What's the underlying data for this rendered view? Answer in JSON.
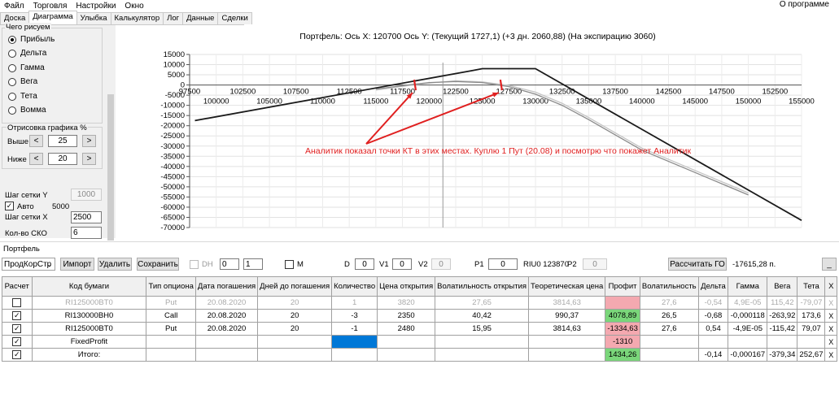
{
  "menu": {
    "items": [
      "Файл",
      "Торговля",
      "Настройки",
      "Окно"
    ],
    "about": "О программе"
  },
  "tabs": [
    "Доска",
    "Диаграмма",
    "Улыбка",
    "Калькулятор",
    "Лог",
    "Данные",
    "Сделки"
  ],
  "active_tab": "Диаграмма",
  "left": {
    "group_title": "Чего рисуем",
    "radios": [
      "Прибыль",
      "Дельта",
      "Гамма",
      "Вега",
      "Тета",
      "Вомма"
    ],
    "selected_radio": "Прибыль",
    "range_title": "Отрисовка графика %",
    "above_label": "Выше",
    "above_value": "25",
    "below_label": "Ниже",
    "below_value": "20",
    "btn_left": "<",
    "btn_right": ">",
    "grid_y_label": "Шаг сетки Y",
    "grid_y_value": "1000",
    "auto_label": "Авто",
    "auto_value": "5000",
    "auto_check": "✓",
    "grid_x_label": "Шаг сетки X",
    "grid_x_value": "2500",
    "sko_label": "Кол-во СКО",
    "sko_value": "6"
  },
  "chart_data": {
    "type": "line",
    "title": "Портфель: Ось X: 120700 Ось Y:  (Текущий 1727,1)  (+3 дн. 2060,88)  (На экспирацию 3060)",
    "xlim": [
      97500,
      155000
    ],
    "ylim": [
      -70000,
      15000
    ],
    "ytick_step": 5000,
    "xticks_top": [
      97500,
      102500,
      107500,
      112500,
      117500,
      122500,
      127500,
      132500,
      137500,
      142500,
      147500,
      152500
    ],
    "xticks_bottom": [
      100000,
      105000,
      110000,
      115000,
      120000,
      125000,
      130000,
      135000,
      140000,
      145000,
      150000,
      155000
    ],
    "cursor_x": 121300,
    "series": [
      {
        "values": [
          [
            98000,
            -17500
          ],
          [
            124000,
            7000
          ],
          [
            125000,
            8000
          ],
          [
            130000,
            8000
          ],
          [
            155000,
            -66500
          ]
        ],
        "color": "#1a1a1a"
      },
      {
        "values": [
          [
            115000,
            -2000
          ],
          [
            118000,
            0
          ],
          [
            120000,
            1200
          ],
          [
            122500,
            1727
          ],
          [
            125000,
            1200
          ],
          [
            127500,
            -800
          ],
          [
            130000,
            -4500
          ],
          [
            132500,
            -10000
          ],
          [
            135000,
            -17000
          ],
          [
            140000,
            -32000
          ],
          [
            145000,
            -43000
          ],
          [
            150000,
            -54000
          ]
        ],
        "color": "#8a8a8a"
      },
      {
        "values": [
          [
            115000,
            -2500
          ],
          [
            118000,
            -300
          ],
          [
            120000,
            900
          ],
          [
            122500,
            2060
          ],
          [
            125000,
            1500
          ],
          [
            127500,
            -200
          ],
          [
            130000,
            -3500
          ],
          [
            132500,
            -9000
          ],
          [
            135000,
            -16000
          ],
          [
            140000,
            -31000
          ],
          [
            145000,
            -42000
          ],
          [
            150000,
            -53000
          ]
        ],
        "color": "#c4c4c4"
      }
    ],
    "annotation": "Аналитик показал точки КТ в этих местах. Куплю 1 Пут (20.08) и посмотрю что покажет Аналитик",
    "annotation_color": "#e02020",
    "marks": [
      [
        118600,
        1000
      ],
      [
        126700,
        1000
      ]
    ]
  },
  "portfolio": {
    "label": "Портфель",
    "combo": "ПродКорСтр",
    "btn_import": "Импорт",
    "btn_delete": "Удалить",
    "btn_save": "Сохранить",
    "dh_label": "DH",
    "dh_v1": "0",
    "dh_v2": "1",
    "m_label": "M",
    "d_label": "D",
    "d_value": "0",
    "v1_label": "V1",
    "v1_value": "0",
    "v2_label": "V2",
    "v2_value": "0",
    "p1_label": "P1",
    "p1_value": "0",
    "riu_label": "RIU0 123870",
    "p2_label": "P2",
    "p2_value": "0",
    "btn_calc": "Рассчитать ГО",
    "go_value": "-17615,28 п.",
    "btn_min": "_"
  },
  "table": {
    "headers": [
      "Расчет",
      "Код бумаги",
      "Тип опциона",
      "Дата погашения",
      "Дней до погашения",
      "Количество",
      "Цена открытия",
      "Волатильность открытия",
      "Теоретическая цена",
      "Профит",
      "Волатильность",
      "Дельта",
      "Гамма",
      "Вега",
      "Тета",
      "X"
    ],
    "rows": [
      [
        "",
        "RI125000BT0",
        "Put",
        "20.08.2020",
        "20",
        "1",
        "3820",
        "27,65",
        "3814,63",
        "",
        "27,6",
        "-0,54",
        "4,9E-05",
        "115,42",
        "-79,07",
        "X"
      ],
      [
        "✓",
        "RI130000BH0",
        "Call",
        "20.08.2020",
        "20",
        "-3",
        "2350",
        "40,42",
        "990,37",
        "4078,89",
        "26,5",
        "-0,68",
        "-0,000118",
        "-263,92",
        "173,6",
        "X"
      ],
      [
        "✓",
        "RI125000BT0",
        "Put",
        "20.08.2020",
        "20",
        "-1",
        "2480",
        "15,95",
        "3814,63",
        "-1334,63",
        "27,6",
        "0,54",
        "-4,9E-05",
        "-115,42",
        "79,07",
        "X"
      ],
      [
        "✓",
        "FixedProfit",
        "",
        "",
        "",
        "",
        "",
        "",
        "",
        "-1310",
        "",
        "",
        "",
        "",
        "",
        "X"
      ],
      [
        "✓",
        "Итого:",
        "",
        "",
        "",
        "",
        "",
        "",
        "",
        "1434,26",
        "",
        "-0,14",
        "-0,000167",
        "-379,34",
        "252,67",
        "X"
      ]
    ]
  }
}
